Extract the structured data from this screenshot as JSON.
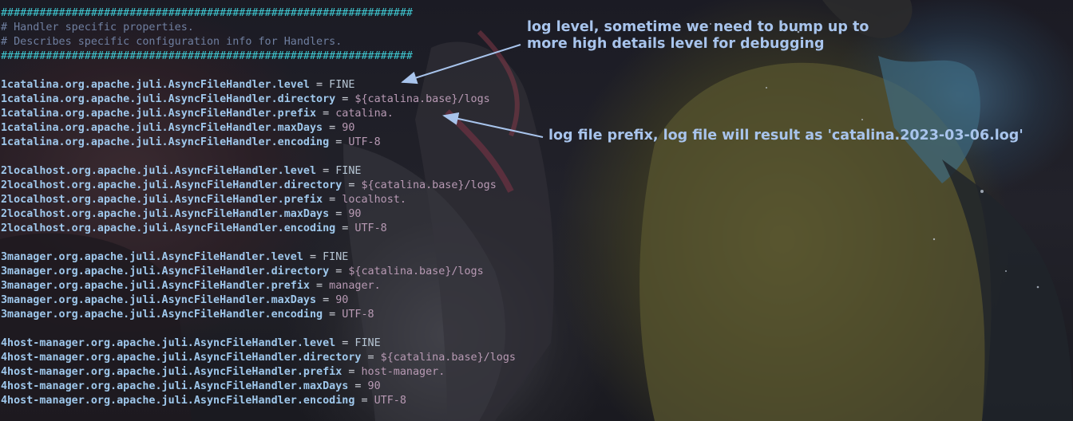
{
  "header": {
    "rule_top": "################################################################",
    "comment1": "# Handler specific properties.",
    "comment2": "# Describes specific configuration info for Handlers.",
    "rule_bottom": "################################################################"
  },
  "blocks": [
    {
      "lines": [
        {
          "key": "1catalina.org.apache.juli.AsyncFileHandler.level",
          "value": "FINE"
        },
        {
          "key": "1catalina.org.apache.juli.AsyncFileHandler.directory",
          "value": "${catalina.base}/logs"
        },
        {
          "key": "1catalina.org.apache.juli.AsyncFileHandler.prefix",
          "value": "catalina."
        },
        {
          "key": "1catalina.org.apache.juli.AsyncFileHandler.maxDays",
          "value": "90"
        },
        {
          "key": "1catalina.org.apache.juli.AsyncFileHandler.encoding",
          "value": "UTF-8"
        }
      ]
    },
    {
      "lines": [
        {
          "key": "2localhost.org.apache.juli.AsyncFileHandler.level",
          "value": "FINE"
        },
        {
          "key": "2localhost.org.apache.juli.AsyncFileHandler.directory",
          "value": "${catalina.base}/logs"
        },
        {
          "key": "2localhost.org.apache.juli.AsyncFileHandler.prefix",
          "value": "localhost."
        },
        {
          "key": "2localhost.org.apache.juli.AsyncFileHandler.maxDays",
          "value": "90"
        },
        {
          "key": "2localhost.org.apache.juli.AsyncFileHandler.encoding",
          "value": "UTF-8"
        }
      ]
    },
    {
      "lines": [
        {
          "key": "3manager.org.apache.juli.AsyncFileHandler.level",
          "value": "FINE"
        },
        {
          "key": "3manager.org.apache.juli.AsyncFileHandler.directory",
          "value": "${catalina.base}/logs"
        },
        {
          "key": "3manager.org.apache.juli.AsyncFileHandler.prefix",
          "value": "manager."
        },
        {
          "key": "3manager.org.apache.juli.AsyncFileHandler.maxDays",
          "value": "90"
        },
        {
          "key": "3manager.org.apache.juli.AsyncFileHandler.encoding",
          "value": "UTF-8"
        }
      ]
    },
    {
      "lines": [
        {
          "key": "4host-manager.org.apache.juli.AsyncFileHandler.level",
          "value": "FINE"
        },
        {
          "key": "4host-manager.org.apache.juli.AsyncFileHandler.directory",
          "value": "${catalina.base}/logs"
        },
        {
          "key": "4host-manager.org.apache.juli.AsyncFileHandler.prefix",
          "value": "host-manager."
        },
        {
          "key": "4host-manager.org.apache.juli.AsyncFileHandler.maxDays",
          "value": "90"
        },
        {
          "key": "4host-manager.org.apache.juli.AsyncFileHandler.encoding",
          "value": "UTF-8"
        }
      ]
    }
  ],
  "equals": "=",
  "annotations": {
    "level_note": "log level, sometime we need to bump up to\nmore high details level for debugging",
    "prefix_note": "log file prefix, log file will result as 'catalina.2023-03-06.log'"
  },
  "colors": {
    "hash_rule": "#3fc9d2",
    "comment": "#6f7fa0",
    "key": "#9fc8ec",
    "value": "#b89ab4",
    "annotation": "#a8c4ec"
  }
}
